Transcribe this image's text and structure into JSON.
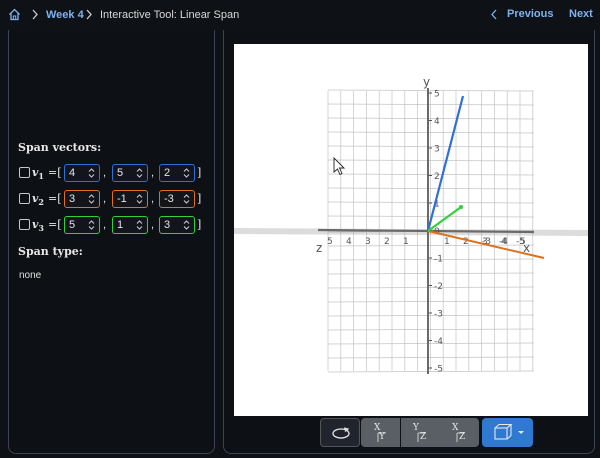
{
  "breadcrumb": {
    "week": "Week 4",
    "tool": "Interactive Tool: Linear Span"
  },
  "nav": {
    "previous": "Previous",
    "next": "Next"
  },
  "panel": {
    "span_vectors_heading": "Span vectors:",
    "span_type_heading": "Span type:",
    "span_type_value": "none",
    "vectors": [
      {
        "name": "v",
        "sub": "1",
        "color": "#2f6fd6",
        "values": [
          "4",
          "5",
          "2"
        ]
      },
      {
        "name": "v",
        "sub": "2",
        "color": "#e0701c",
        "values": [
          "3",
          "-1",
          "-3"
        ]
      },
      {
        "name": "v",
        "sub": "3",
        "color": "#2fd23a",
        "values": [
          "5",
          "1",
          "3"
        ]
      }
    ],
    "eq": "=[",
    "comma": ",",
    "close": "]"
  },
  "plot": {
    "x_label": "x",
    "y_label": "y",
    "z_label": "z",
    "y_ticks": [
      "5",
      "4",
      "3",
      "2",
      "1",
      "0",
      "-1",
      "-2",
      "-3",
      "-4",
      "-5"
    ],
    "x_ticks": [
      "1",
      "2",
      "3",
      "4",
      "5"
    ],
    "z_ticks": [
      "5",
      "4",
      "3",
      "2",
      "1"
    ],
    "neg_x_ticks": [
      "-3",
      "-4",
      "-5"
    ]
  },
  "toolbar": {
    "xy_top": "X",
    "xy_bot": "Y",
    "yz_top": "Y",
    "yz_bot": "Z",
    "xz_top": "X",
    "xz_bot": "Z"
  },
  "colors": {
    "accent": "#7fb2f0",
    "v1": "#2f6fd6",
    "v2": "#e0701c",
    "v3": "#2fd23a"
  }
}
